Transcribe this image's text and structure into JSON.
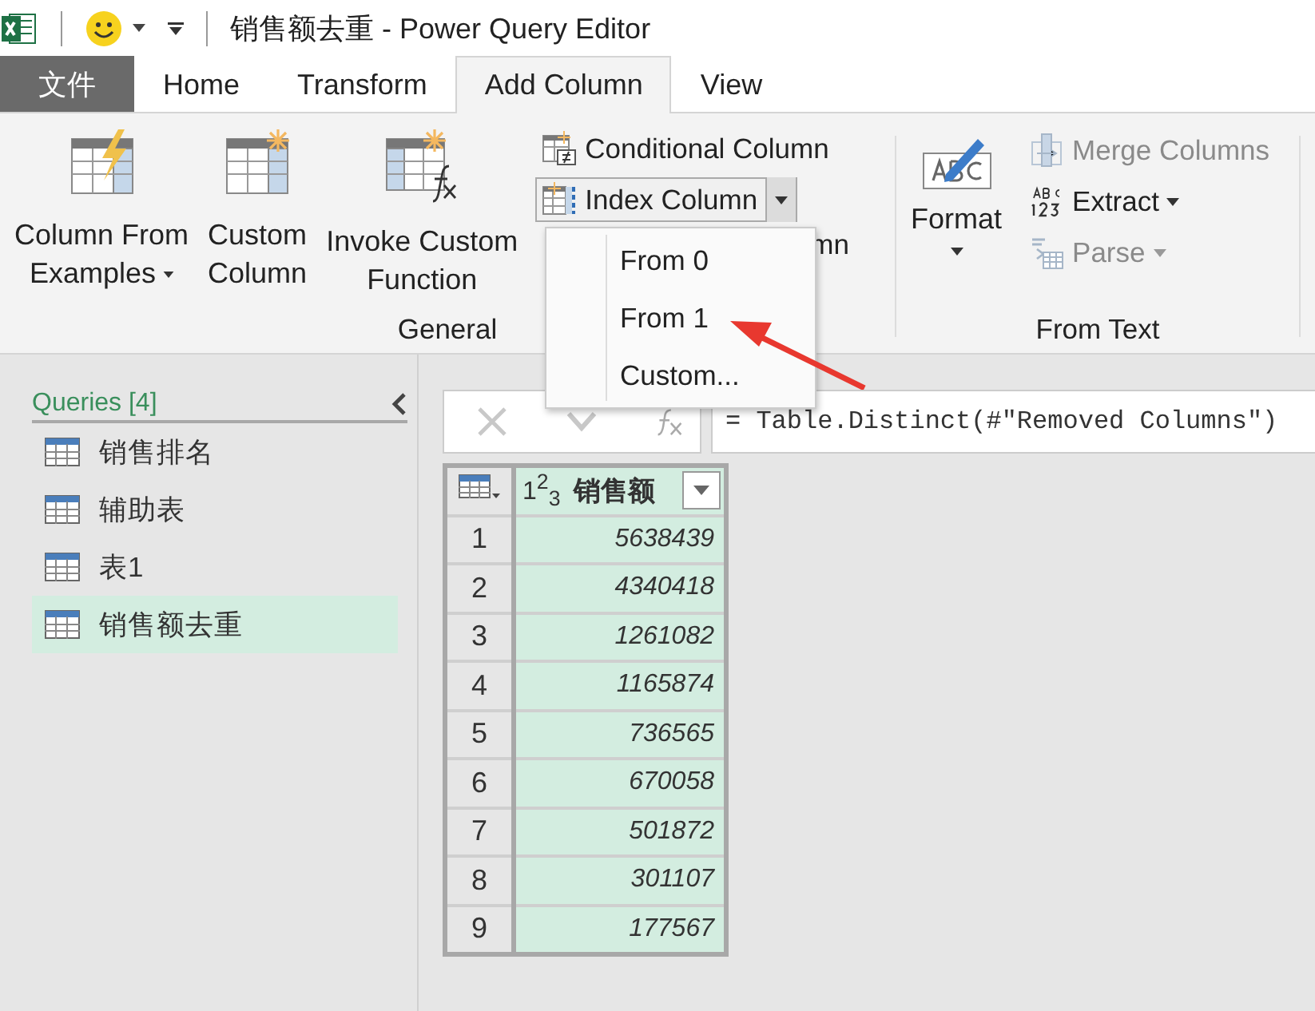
{
  "window": {
    "title": "销售额去重 - Power Query Editor"
  },
  "file_tab": "文件",
  "tabs": [
    {
      "label": "Home",
      "selected": false
    },
    {
      "label": "Transform",
      "selected": false
    },
    {
      "label": "Add Column",
      "selected": true
    },
    {
      "label": "View",
      "selected": false
    }
  ],
  "ribbon": {
    "general": {
      "label": "General",
      "big_buttons": [
        {
          "kind": "examples",
          "lines": [
            "Column From",
            "Examples"
          ],
          "dropdown": true
        },
        {
          "kind": "custom",
          "lines": [
            "Custom",
            "Column"
          ],
          "dropdown": false
        },
        {
          "kind": "invoke",
          "lines": [
            "Invoke Custom",
            "Function"
          ],
          "dropdown": false
        }
      ],
      "small_buttons": [
        {
          "kind": "conditional",
          "label": "Conditional Column",
          "dropdown": false,
          "open": false
        },
        {
          "kind": "index",
          "label": "Index Column",
          "dropdown": true,
          "open": true
        }
      ],
      "hidden_label": "mn"
    },
    "from_text": {
      "label": "From Text",
      "format": {
        "label": "Format",
        "dropdown": true
      },
      "small_buttons": [
        {
          "kind": "merge",
          "label": "Merge Columns",
          "disabled": true,
          "dropdown": false
        },
        {
          "kind": "extract",
          "label": "Extract",
          "disabled": false,
          "dropdown": true
        },
        {
          "kind": "parse",
          "label": "Parse",
          "disabled": true,
          "dropdown": true
        }
      ]
    }
  },
  "dropdown_menu": [
    "From 0",
    "From 1",
    "Custom..."
  ],
  "queries": {
    "header": "Queries [4]",
    "items": [
      {
        "label": "销售排名",
        "selected": false
      },
      {
        "label": "辅助表",
        "selected": false
      },
      {
        "label": "表1",
        "selected": false
      },
      {
        "label": "销售额去重",
        "selected": true
      }
    ]
  },
  "formula_bar": {
    "formula": "= Table.Distinct(#\"Removed Columns\")"
  },
  "table": {
    "column": {
      "type_label": "1$^{2}$$_{3}$",
      "name": "销售额"
    },
    "rows": [
      {
        "index": "1",
        "value": "5638439"
      },
      {
        "index": "2",
        "value": "4340418"
      },
      {
        "index": "3",
        "value": "1261082"
      },
      {
        "index": "4",
        "value": "1165874"
      },
      {
        "index": "5",
        "value": "736565"
      },
      {
        "index": "6",
        "value": "670058"
      },
      {
        "index": "7",
        "value": "501872"
      },
      {
        "index": "8",
        "value": "301107"
      },
      {
        "index": "9",
        "value": "177567"
      }
    ]
  }
}
